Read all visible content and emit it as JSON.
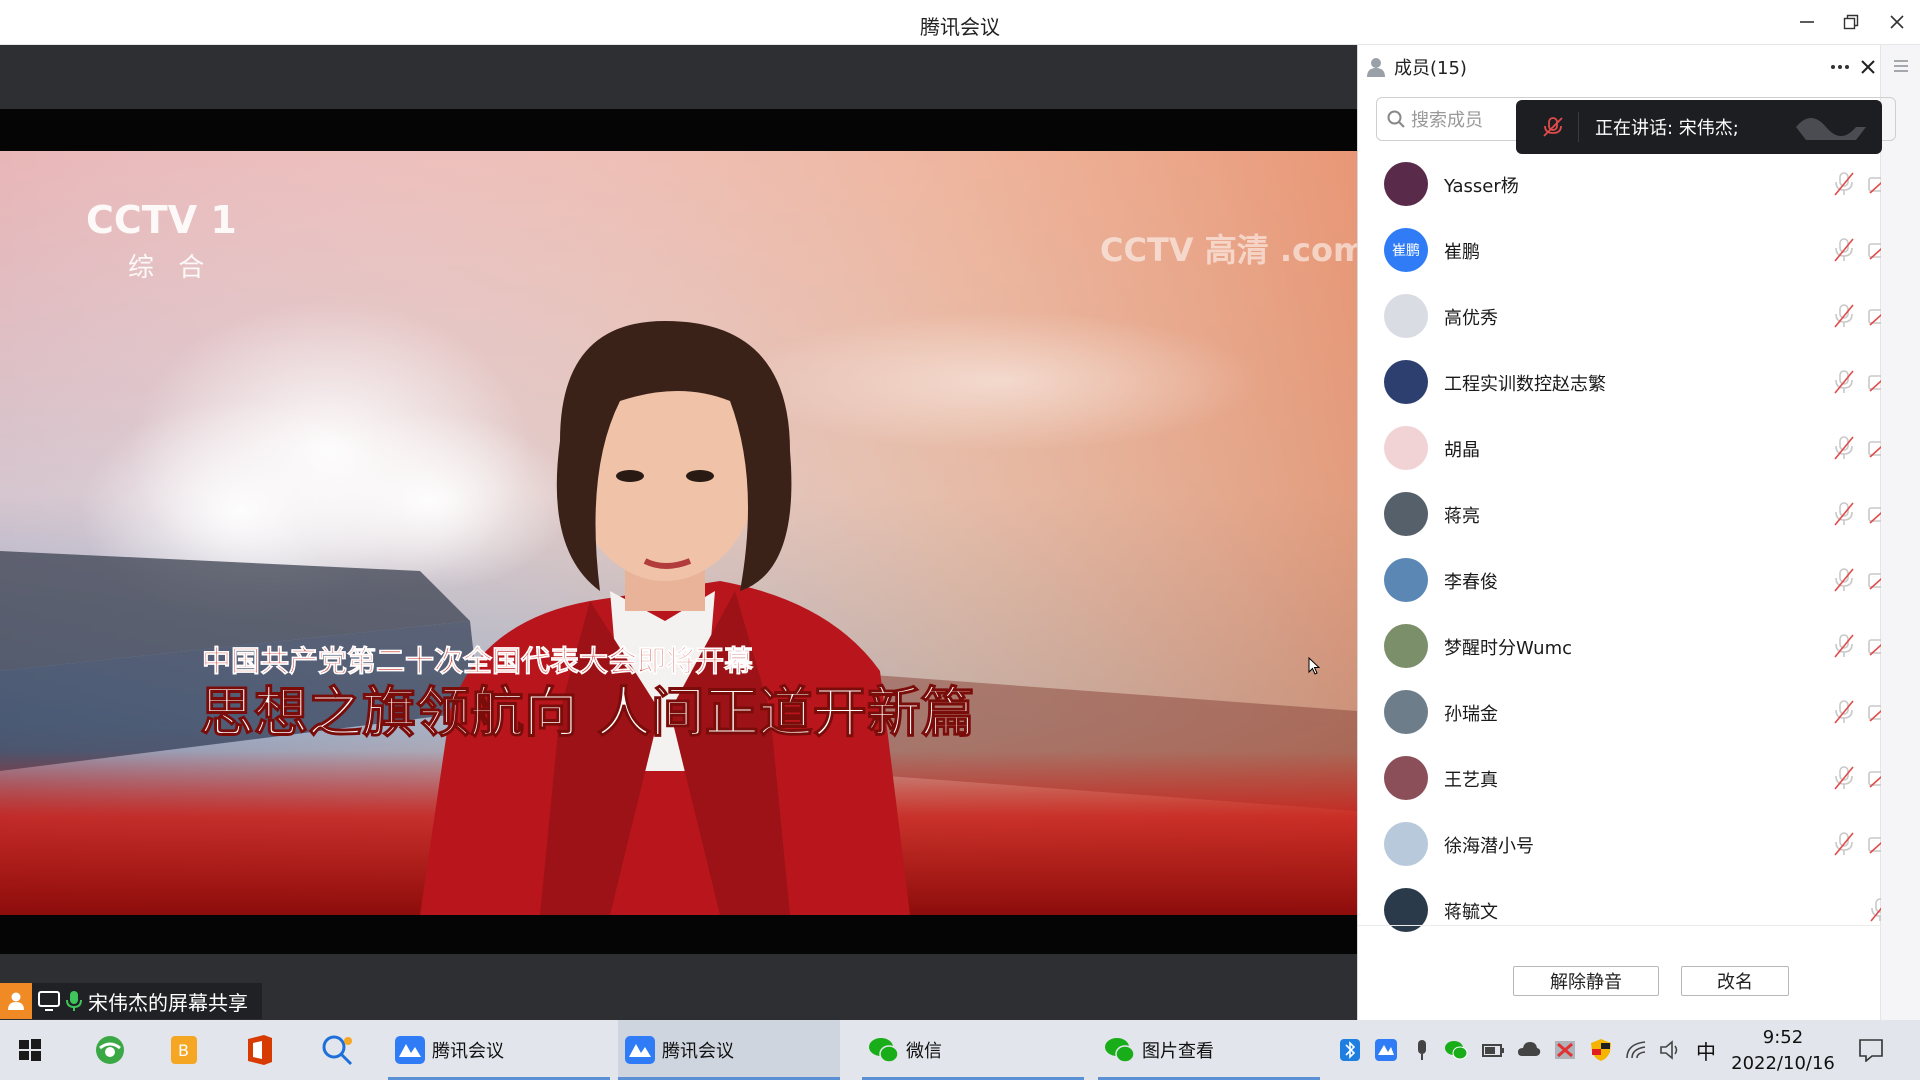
{
  "window": {
    "title": "腾讯会议"
  },
  "video": {
    "channel_logo": "CCTV 1",
    "channel_sub": "综 合",
    "watermark": "CCTV 高清 .com",
    "caption_top": "中国共产党第二十次全国代表大会即将开幕",
    "caption_main": "思想之旗领航向 人间正道开新篇"
  },
  "share_label": "宋伟杰的屏幕共享",
  "members_panel": {
    "title": "成员(15)",
    "search_placeholder": "搜索成员",
    "speaking_text": "正在讲话: 宋伟杰;",
    "members": [
      {
        "name": "Yasser杨",
        "avatar_text": "",
        "avatar_color": "#5a2a4a",
        "mic": "muted",
        "cam": "off"
      },
      {
        "name": "崔鹏",
        "avatar_text": "崔鹏",
        "avatar_color": "#2f7cf6",
        "mic": "muted",
        "cam": "off"
      },
      {
        "name": "高优秀",
        "avatar_text": "",
        "avatar_color": "#d9dde3",
        "mic": "muted",
        "cam": "off"
      },
      {
        "name": "工程实训数控赵志繁",
        "avatar_text": "",
        "avatar_color": "#2d3f6e",
        "mic": "muted",
        "cam": "off"
      },
      {
        "name": "胡晶",
        "avatar_text": "",
        "avatar_color": "#f1d3d6",
        "mic": "muted",
        "cam": "off"
      },
      {
        "name": "蒋亮",
        "avatar_text": "",
        "avatar_color": "#55606a",
        "mic": "muted",
        "cam": "off"
      },
      {
        "name": "李春俊",
        "avatar_text": "",
        "avatar_color": "#5b87b5",
        "mic": "muted",
        "cam": "off"
      },
      {
        "name": "梦醒时分Wumc",
        "avatar_text": "",
        "avatar_color": "#7b8f6a",
        "mic": "muted",
        "cam": "off"
      },
      {
        "name": "孙瑞金",
        "avatar_text": "",
        "avatar_color": "#6e7d8a",
        "mic": "muted",
        "cam": "off"
      },
      {
        "name": "王艺真",
        "avatar_text": "",
        "avatar_color": "#8a4f58",
        "mic": "muted",
        "cam": "off"
      },
      {
        "name": "徐海潜小号",
        "avatar_text": "",
        "avatar_color": "#b8c9dc",
        "mic": "muted",
        "cam": "off"
      },
      {
        "name": "蒋毓文",
        "avatar_text": "",
        "avatar_color": "#2b3a4a",
        "mic": "muted",
        "cam": "none"
      }
    ],
    "unmute_button": "解除静音",
    "rename_button": "改名"
  },
  "taskbar": {
    "items": [
      {
        "label": "腾讯会议",
        "active": false
      },
      {
        "label": "腾讯会议",
        "active": true
      },
      {
        "label": "微信",
        "active": false
      },
      {
        "label": "图片查看",
        "active": false
      }
    ],
    "ime": "中",
    "time": "9:52",
    "date": "2022/10/16"
  },
  "colors": {
    "accent": "#2f7cf6",
    "muted_red": "#e04b4b",
    "share_orange": "#f08a24"
  }
}
